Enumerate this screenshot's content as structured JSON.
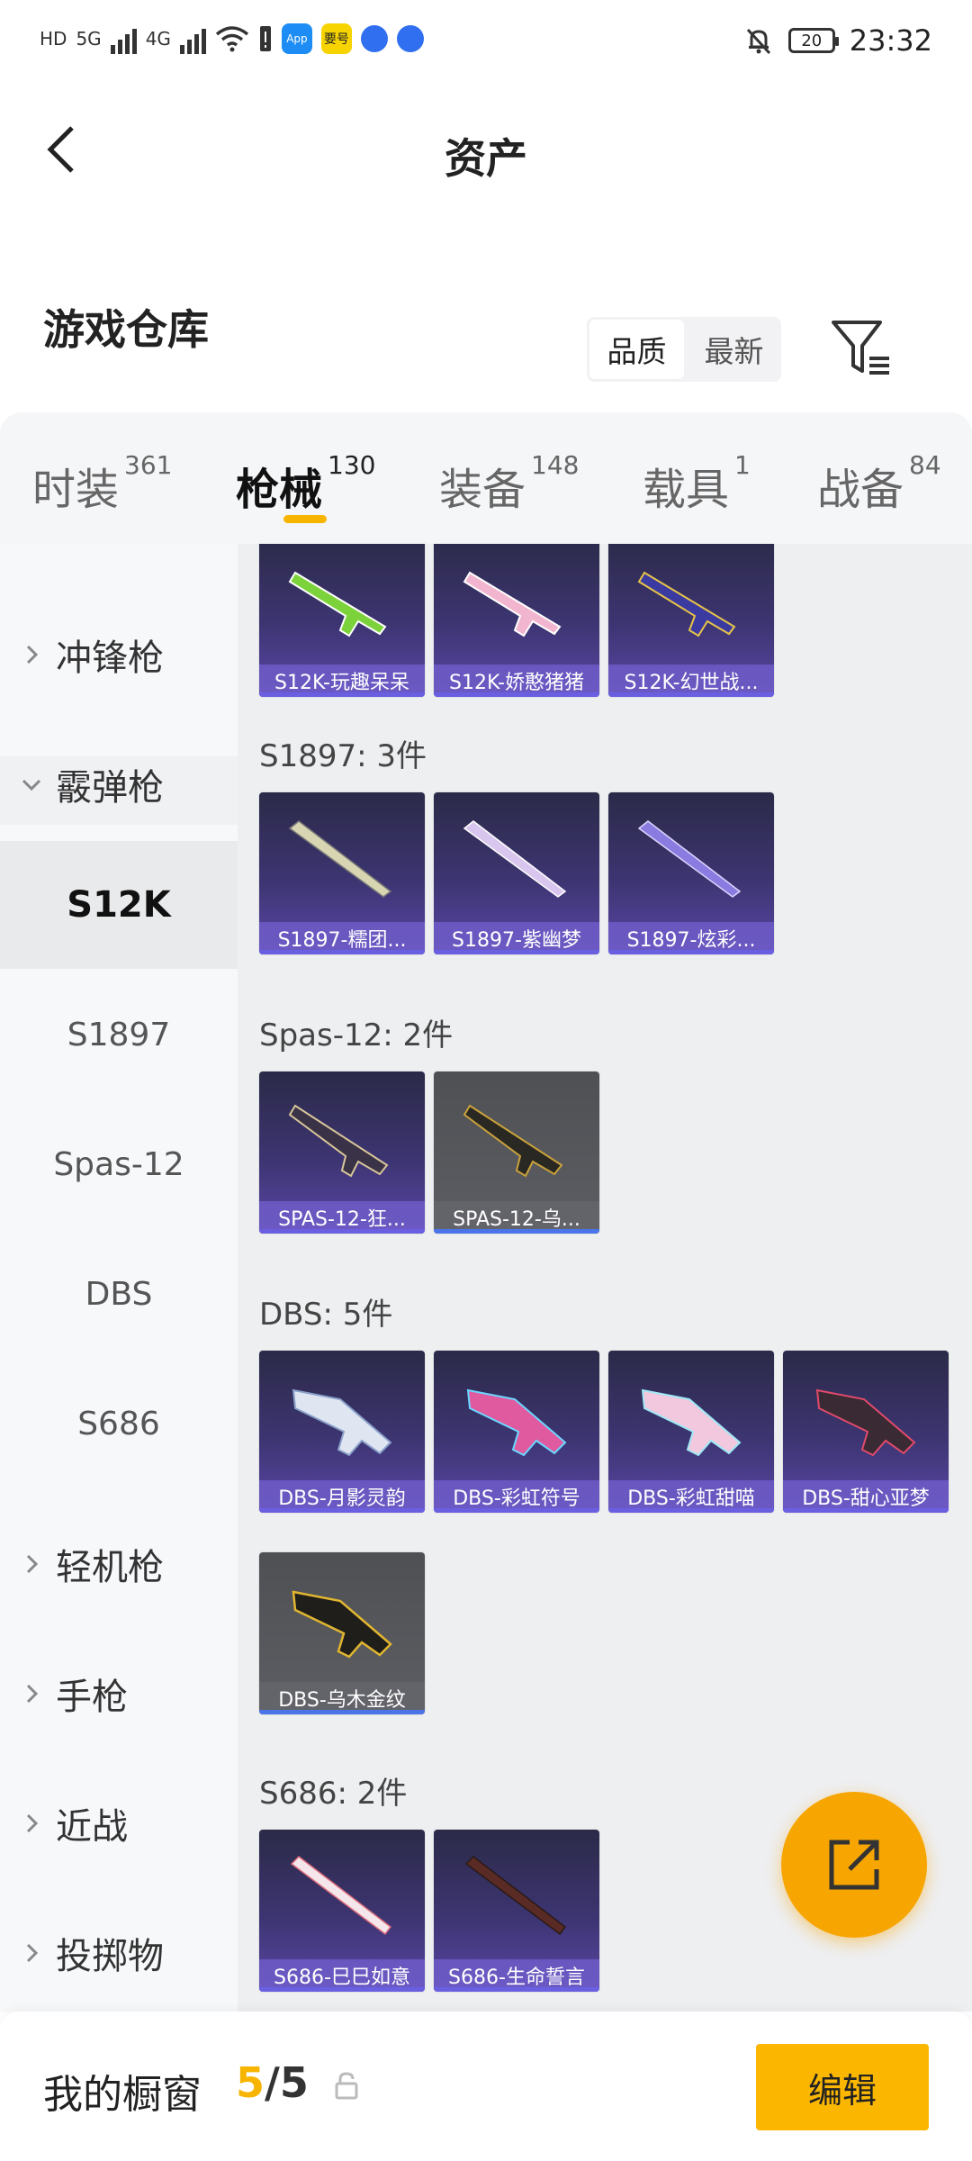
{
  "status_bar": {
    "left_labels": [
      "HD",
      "5G",
      "4G"
    ],
    "app_badge": "App",
    "app_badge2": "要号",
    "battery": "20",
    "time": "23:32"
  },
  "header": {
    "title": "资产",
    "back_icon": "back-arrow-icon"
  },
  "warehouse": {
    "title": "游戏仓库",
    "sort_options": [
      "品质",
      "最新"
    ],
    "selected_sort": "品质",
    "filter_icon": "filter-icon"
  },
  "tabs": [
    {
      "label": "时装",
      "count": "361"
    },
    {
      "label": "枪械",
      "count": "130"
    },
    {
      "label": "装备",
      "count": "148"
    },
    {
      "label": "载具",
      "count": "1"
    },
    {
      "label": "战备",
      "count": "84"
    }
  ],
  "active_tab": "枪械",
  "sidebar": {
    "categories": [
      {
        "label": "冲锋枪",
        "icon": "chevron-right-icon"
      },
      {
        "label": "霰弹枪",
        "icon": "chevron-down-icon"
      },
      {
        "label": "轻机枪",
        "icon": "chevron-right-icon"
      },
      {
        "label": "手枪",
        "icon": "chevron-right-icon"
      },
      {
        "label": "近战",
        "icon": "chevron-right-icon"
      },
      {
        "label": "投掷物",
        "icon": "chevron-right-icon"
      }
    ],
    "subitems": [
      "S12K",
      "S1897",
      "Spas-12",
      "DBS",
      "S686"
    ],
    "active_subitem": "S12K"
  },
  "content": {
    "top_row": [
      "S12K-玩趣呆呆",
      "S12K-娇憨猪猪",
      "S12K-幻世战..."
    ],
    "groups": [
      {
        "label": "S1897: 3件",
        "items": [
          "S1897-糯团...",
          "S1897-紫幽梦",
          "S1897-炫彩..."
        ]
      },
      {
        "label": "Spas-12: 2件",
        "items": [
          "SPAS-12-狂...",
          "SPAS-12-乌..."
        ]
      },
      {
        "label": "DBS: 5件",
        "items": [
          "DBS-月影灵韵",
          "DBS-彩虹符号",
          "DBS-彩虹甜喵",
          "DBS-甜心亚梦",
          "DBS-乌木金纹"
        ]
      },
      {
        "label": "S686: 2件",
        "items": [
          "S686-巳巳如意",
          "S686-生命誓言"
        ]
      }
    ]
  },
  "fab_icon": "share-export-icon",
  "bottom_bar": {
    "label": "我的橱窗",
    "count_current": "5",
    "count_sep": "/",
    "count_total": "5",
    "lock_icon": "lock-icon",
    "edit_label": "编辑"
  },
  "colors": {
    "accent": "#f7b500",
    "card_purple": "#5a46a6",
    "card_gray": "#5d5e63"
  }
}
